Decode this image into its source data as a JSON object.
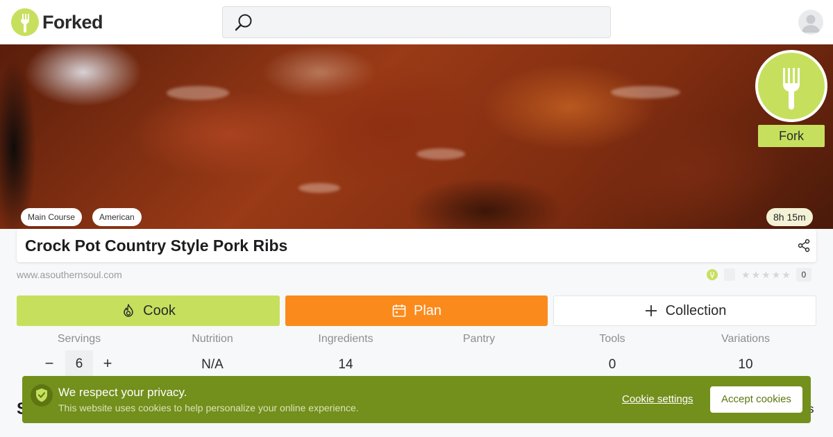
{
  "header": {
    "logo_text": "Forked",
    "search": {
      "placeholder": "",
      "value": ""
    }
  },
  "hero": {
    "tags": [
      "Main Course",
      "American"
    ],
    "time": "8h 15m",
    "fork_label": "Fork"
  },
  "recipe": {
    "title": "Crock Pot Country Style Pork Ribs",
    "source": "www.asouthernsoul.com",
    "rating_count": "0",
    "stars": 5
  },
  "actions": {
    "cook_label": "Cook",
    "plan_label": "Plan",
    "collection_label": "Collection"
  },
  "stats": [
    {
      "label": "Servings",
      "value": "6"
    },
    {
      "label": "Nutrition",
      "value": "N/A"
    },
    {
      "label": "Ingredients",
      "value": "14"
    },
    {
      "label": "Pantry",
      "value": ""
    },
    {
      "label": "Tools",
      "value": "0"
    },
    {
      "label": "Variations",
      "value": "10"
    }
  ],
  "servings_controls": {
    "minus": "−",
    "plus": "+"
  },
  "below_fold": {
    "left_text": "S",
    "right_text": "s"
  },
  "cookie_banner": {
    "title": "We respect your privacy.",
    "text": "This website uses cookies to help personalize your online experience.",
    "settings_label": "Cookie settings",
    "accept_label": "Accept cookies"
  },
  "colors": {
    "brand_green": "#c6e05e",
    "plan_orange": "#fb8a1c",
    "cookie_banner": "#738f1c"
  }
}
